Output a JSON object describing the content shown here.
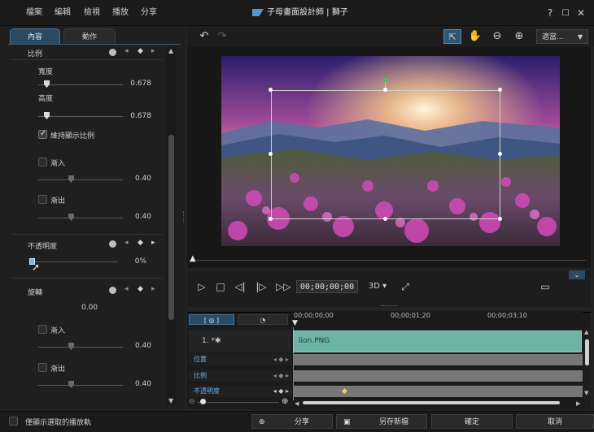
{
  "menu": [
    "檔案",
    "編輯",
    "檢視",
    "播放",
    "分享"
  ],
  "title": "子母畫面設計師 | 獅子",
  "window_controls": [
    "?",
    "□",
    "✕"
  ],
  "tabs": {
    "content": "內容",
    "motion": "動作"
  },
  "properties": {
    "scale": {
      "label": "比例",
      "width_label": "寬度",
      "width_value": "0.678",
      "height_label": "高度",
      "height_value": "0.678",
      "keep_ratio": "維持顯示比例",
      "fade_in": "漸入",
      "fade_in_value": "0.40",
      "fade_out": "漸出",
      "fade_out_value": "0.40"
    },
    "opacity": {
      "label": "不透明度",
      "value": "0%"
    },
    "rotation": {
      "label": "旋轉",
      "value": "0.00",
      "fade_in": "漸入",
      "fade_in_value": "0.40",
      "fade_out": "漸出",
      "fade_out_value": "0.40"
    }
  },
  "toolbar": {
    "undo": "↶",
    "redo": "↷",
    "zoom_select": "適當..."
  },
  "playback": {
    "timecode": "00;00;00;00",
    "mode_3d": "3D ▾"
  },
  "timeline": {
    "tabs": [
      "[ ◎ ]",
      "◔"
    ],
    "ruler": [
      "00;00;00;00",
      "00;00;01;20",
      "00;00;03;10"
    ],
    "track_name": "1. *✱",
    "clip_name": "lion.PNG",
    "rows": [
      "位置",
      "比例",
      "不透明度"
    ]
  },
  "bottom": {
    "checkbox_label": "僅顯示選取的播放軌",
    "share": "分享",
    "save_as": "另存新檔",
    "ok": "確定",
    "cancel": "取消"
  },
  "colors": {
    "accent": "#4e9ad7",
    "clip": "#6db3a6",
    "row_label": "#6fb0e6",
    "keyframe": "#f0d060"
  }
}
